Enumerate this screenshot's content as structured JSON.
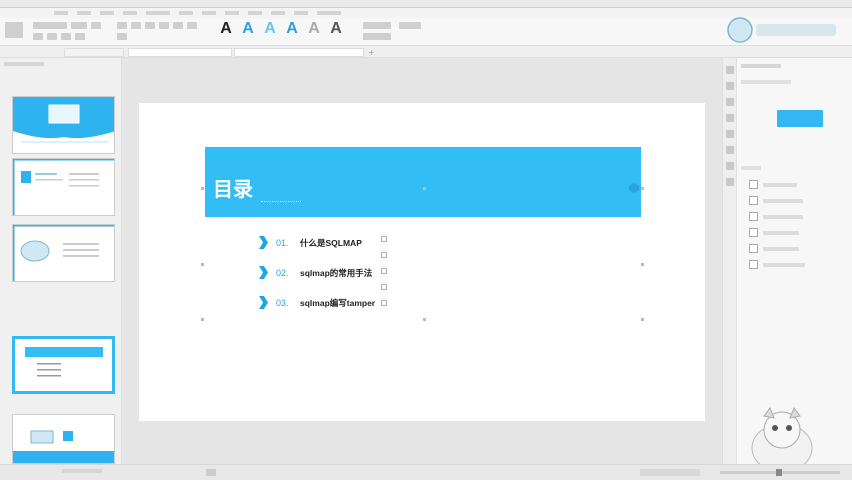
{
  "slide": {
    "banner_title": "目录",
    "toc": [
      {
        "num": "01.",
        "text": "什么是SQLMAP"
      },
      {
        "num": "02.",
        "text": "sqlmap的常用手法"
      },
      {
        "num": "03.",
        "text": "sqlmap编写tamper"
      }
    ]
  },
  "colors": {
    "accent": "#33bdf5",
    "chevron": "#1ea7e5",
    "button": "#33b6f2"
  },
  "icons": [
    "chevron-right-icon",
    "slide-thumbnail-icon",
    "template-icon"
  ]
}
